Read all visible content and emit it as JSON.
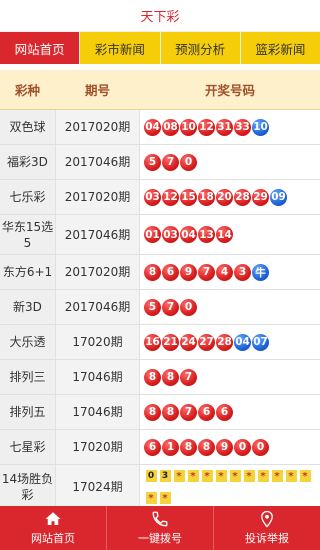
{
  "title": "天下彩",
  "tabs": [
    {
      "label": "网站首页",
      "active": true
    },
    {
      "label": "彩市新闻",
      "active": false
    },
    {
      "label": "预测分析",
      "active": false
    },
    {
      "label": "篮彩新闻",
      "active": false
    }
  ],
  "table": {
    "headers": [
      "彩种",
      "期号",
      "开奖号码"
    ],
    "rows": [
      {
        "name": "双色球",
        "issue": "2017020期",
        "balls": [
          "04",
          "08",
          "10",
          "12",
          "31",
          "33"
        ],
        "blue": [
          "10"
        ]
      },
      {
        "name": "福彩3D",
        "issue": "2017046期",
        "balls": [
          "5",
          "7",
          "0"
        ],
        "blue": []
      },
      {
        "name": "七乐彩",
        "issue": "2017020期",
        "balls": [
          "03",
          "12",
          "15",
          "18",
          "20",
          "28",
          "29"
        ],
        "blue": [
          "09"
        ]
      },
      {
        "name": "华东15选5",
        "issue": "2017046期",
        "balls": [
          "01",
          "03",
          "04",
          "13",
          "14"
        ],
        "blue": []
      },
      {
        "name": "东方6+1",
        "issue": "2017020期",
        "balls": [
          "8",
          "6",
          "9",
          "7",
          "4",
          "3"
        ],
        "blue": [
          "牛"
        ]
      },
      {
        "name": "新3D",
        "issue": "2017046期",
        "balls": [
          "5",
          "7",
          "0"
        ],
        "blue": []
      },
      {
        "name": "大乐透",
        "issue": "17020期",
        "balls": [
          "16",
          "21",
          "24",
          "27",
          "28"
        ],
        "blue": [
          "04",
          "07"
        ]
      },
      {
        "name": "排列三",
        "issue": "17046期",
        "balls": [
          "8",
          "8",
          "7"
        ],
        "blue": []
      },
      {
        "name": "排列五",
        "issue": "17046期",
        "balls": [
          "8",
          "8",
          "7",
          "6",
          "6"
        ],
        "blue": []
      },
      {
        "name": "七星彩",
        "issue": "17020期",
        "balls": [
          "6",
          "1",
          "8",
          "8",
          "9",
          "0",
          "0"
        ],
        "blue": []
      },
      {
        "name": "14场胜负彩",
        "issue": "17024期",
        "squares": [
          "0",
          "3",
          "*",
          "*",
          "*",
          "*",
          "*",
          "*",
          "*",
          "*",
          "*",
          "*",
          "*",
          "*"
        ]
      }
    ]
  },
  "bottom_nav": [
    {
      "label": "网站首页",
      "icon": "home-icon"
    },
    {
      "label": "一键拨号",
      "icon": "phone-icon"
    },
    {
      "label": "投诉举报",
      "icon": "location-pin-icon"
    }
  ],
  "colors": {
    "accent": "#d9272d",
    "tab_bg": "#f5cd08",
    "header_bg": "#fdf0ca",
    "ball_red": "#d81e1e",
    "ball_blue": "#1e63d8"
  }
}
